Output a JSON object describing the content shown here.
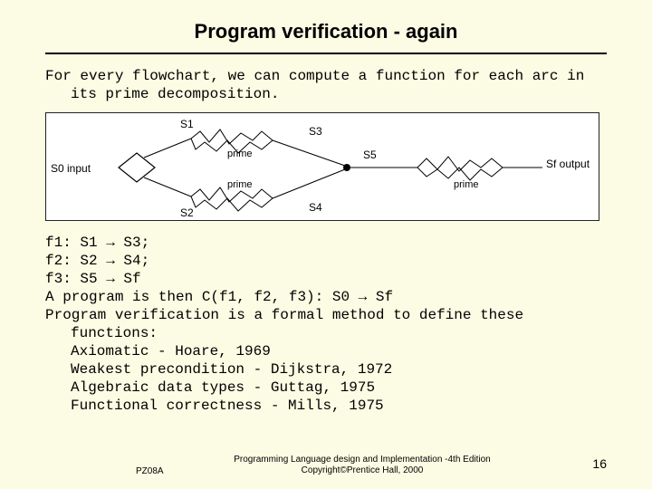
{
  "title": "Program verification - again",
  "intro": "For every flowchart, we can compute a function for each arc in its prime decomposition.",
  "diagram": {
    "labels": {
      "s0": "S0 input",
      "s1": "S1",
      "s2": "S2",
      "s3": "S3",
      "s4": "S4",
      "s5": "S5",
      "sf": "Sf output",
      "prime": "prime"
    }
  },
  "lines": {
    "f1": "f1: S1 → S3;",
    "f2": "f2: S2 → S4;",
    "f3": "f3: S5 → Sf",
    "prog": "A program is then C(f1, f2, f3): S0 → Sf",
    "pv": "Program verification is a formal method to define these functions:",
    "ax": "Axiomatic - Hoare, 1969",
    "wp": "Weakest precondition - Dijkstra, 1972",
    "adt": "Algebraic data types - Guttag, 1975",
    "fc": "Functional correctness - Mills, 1975"
  },
  "footer": {
    "left": "PZ08A",
    "center1": "Programming Language design and Implementation -4th Edition",
    "center2": "Copyright©Prentice Hall, 2000",
    "pageno": "16"
  }
}
